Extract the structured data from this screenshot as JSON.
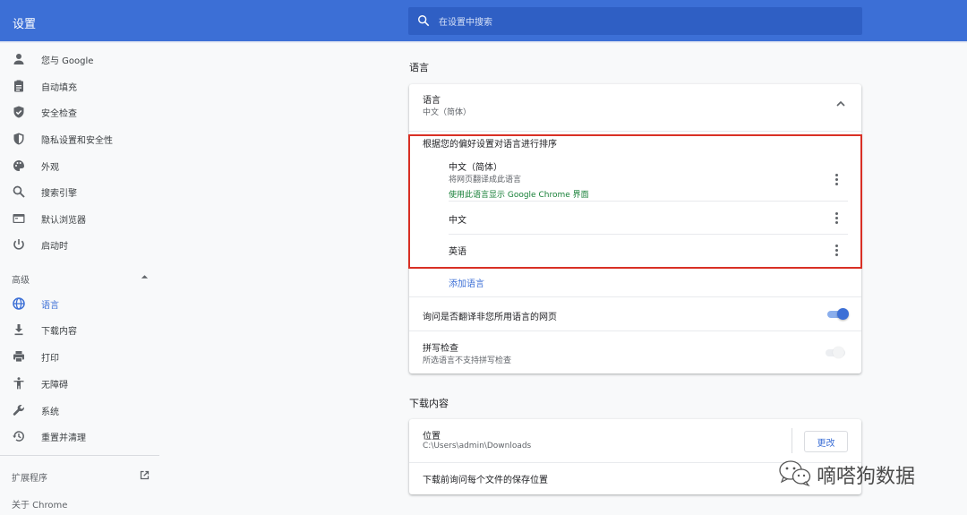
{
  "header": {
    "title": "设置",
    "search_placeholder": "在设置中搜索"
  },
  "sidebar": {
    "items": [
      {
        "label": "您与 Google",
        "icon": "person-icon"
      },
      {
        "label": "自动填充",
        "icon": "clipboard-icon"
      },
      {
        "label": "安全检查",
        "icon": "shield-check-icon"
      },
      {
        "label": "隐私设置和安全性",
        "icon": "shield-half-icon"
      },
      {
        "label": "外观",
        "icon": "palette-icon"
      },
      {
        "label": "搜索引擎",
        "icon": "search-icon"
      },
      {
        "label": "默认浏览器",
        "icon": "browser-icon"
      },
      {
        "label": "启动时",
        "icon": "power-icon"
      }
    ],
    "advanced_label": "高级",
    "advanced_items": [
      {
        "label": "语言",
        "icon": "globe-icon",
        "active": true
      },
      {
        "label": "下载内容",
        "icon": "download-icon"
      },
      {
        "label": "打印",
        "icon": "printer-icon"
      },
      {
        "label": "无障碍",
        "icon": "accessibility-icon"
      },
      {
        "label": "系统",
        "icon": "wrench-icon"
      },
      {
        "label": "重置并清理",
        "icon": "restore-icon"
      }
    ],
    "extensions_label": "扩展程序",
    "about_label": "关于 Chrome"
  },
  "language_section": {
    "title": "语言",
    "header_label": "语言",
    "header_value": "中文（简体）",
    "order_label": "根据您的偏好设置对语言进行排序",
    "languages": [
      {
        "name": "中文（简体）",
        "detail": "将网页翻译成此语言",
        "ui_note": "使用此语言显示 Google Chrome 界面"
      },
      {
        "name": "中文"
      },
      {
        "name": "英语"
      }
    ],
    "add_language": "添加语言",
    "translate_label": "询问是否翻译非您所用语言的网页",
    "translate_enabled": true,
    "spellcheck_label": "拼写检查",
    "spellcheck_sub": "所选语言不支持拼写检查",
    "spellcheck_enabled": false
  },
  "downloads_section": {
    "title": "下载内容",
    "location_label": "位置",
    "location_path": "C:\\Users\\admin\\Downloads",
    "change_button": "更改",
    "ask_label": "下载前询问每个文件的保存位置"
  },
  "watermark": {
    "text": "嘀嗒狗数据",
    "icon": "wechat-icon"
  },
  "colors": {
    "accent": "#3c6fd6",
    "highlight": "#d93025",
    "green": "#188038"
  }
}
